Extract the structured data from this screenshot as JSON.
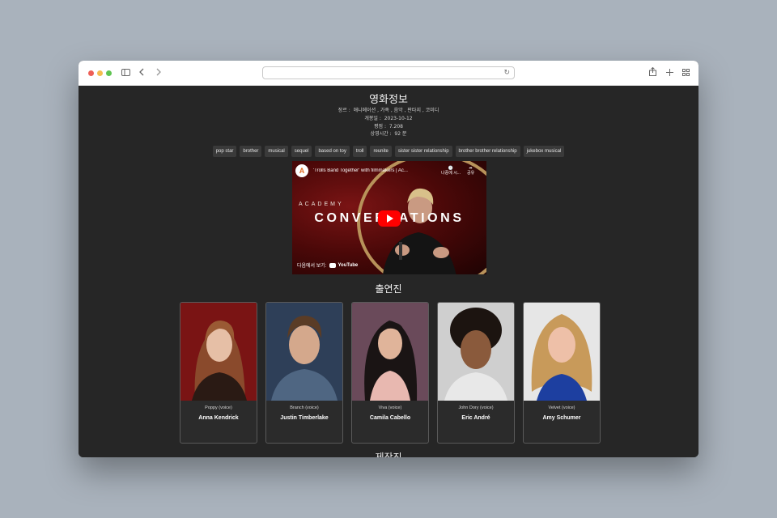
{
  "page": {
    "title": "영화정보",
    "info": [
      {
        "label": "장르 :",
        "value": "애니메이션 , 가족 , 음악 , 판타지 , 코미디"
      },
      {
        "label": "개봉일 :",
        "value": "2023-10-12"
      },
      {
        "label": "평점 :",
        "value": "7.208"
      },
      {
        "label": "상영시간 :",
        "value": "92 분"
      }
    ],
    "tags": [
      "pop star",
      "brother",
      "musical",
      "sequel",
      "based on toy",
      "troll",
      "reunite",
      "sister sister relationship",
      "brother brother relationship",
      "jukebox musical"
    ]
  },
  "video": {
    "channel_initial": "A",
    "title": "'Trolls Band Together' with filmmakers | Ac...",
    "later_label": "나중에 시...",
    "share_label": "공유",
    "academy_text": "ACADEMY",
    "conversations_text": "CONVERSATIONS",
    "watch_on_label": "다음에서 보기:",
    "youtube_label": "YouTube"
  },
  "cast": {
    "title": "출연진",
    "members": [
      {
        "role": "Poppy (voice)",
        "name": "Anna Kendrick"
      },
      {
        "role": "Branch (voice)",
        "name": "Justin Timberlake"
      },
      {
        "role": "Viva (voice)",
        "name": "Camila Cabello"
      },
      {
        "role": "John Dory (voice)",
        "name": "Eric André"
      },
      {
        "role": "Velvet (voice)",
        "name": "Amy Schumer"
      }
    ]
  },
  "crew": {
    "title": "제작진"
  },
  "colors": {
    "background": "#262626",
    "youtube_red": "#ff0000",
    "academy_gold": "#b8925a"
  }
}
